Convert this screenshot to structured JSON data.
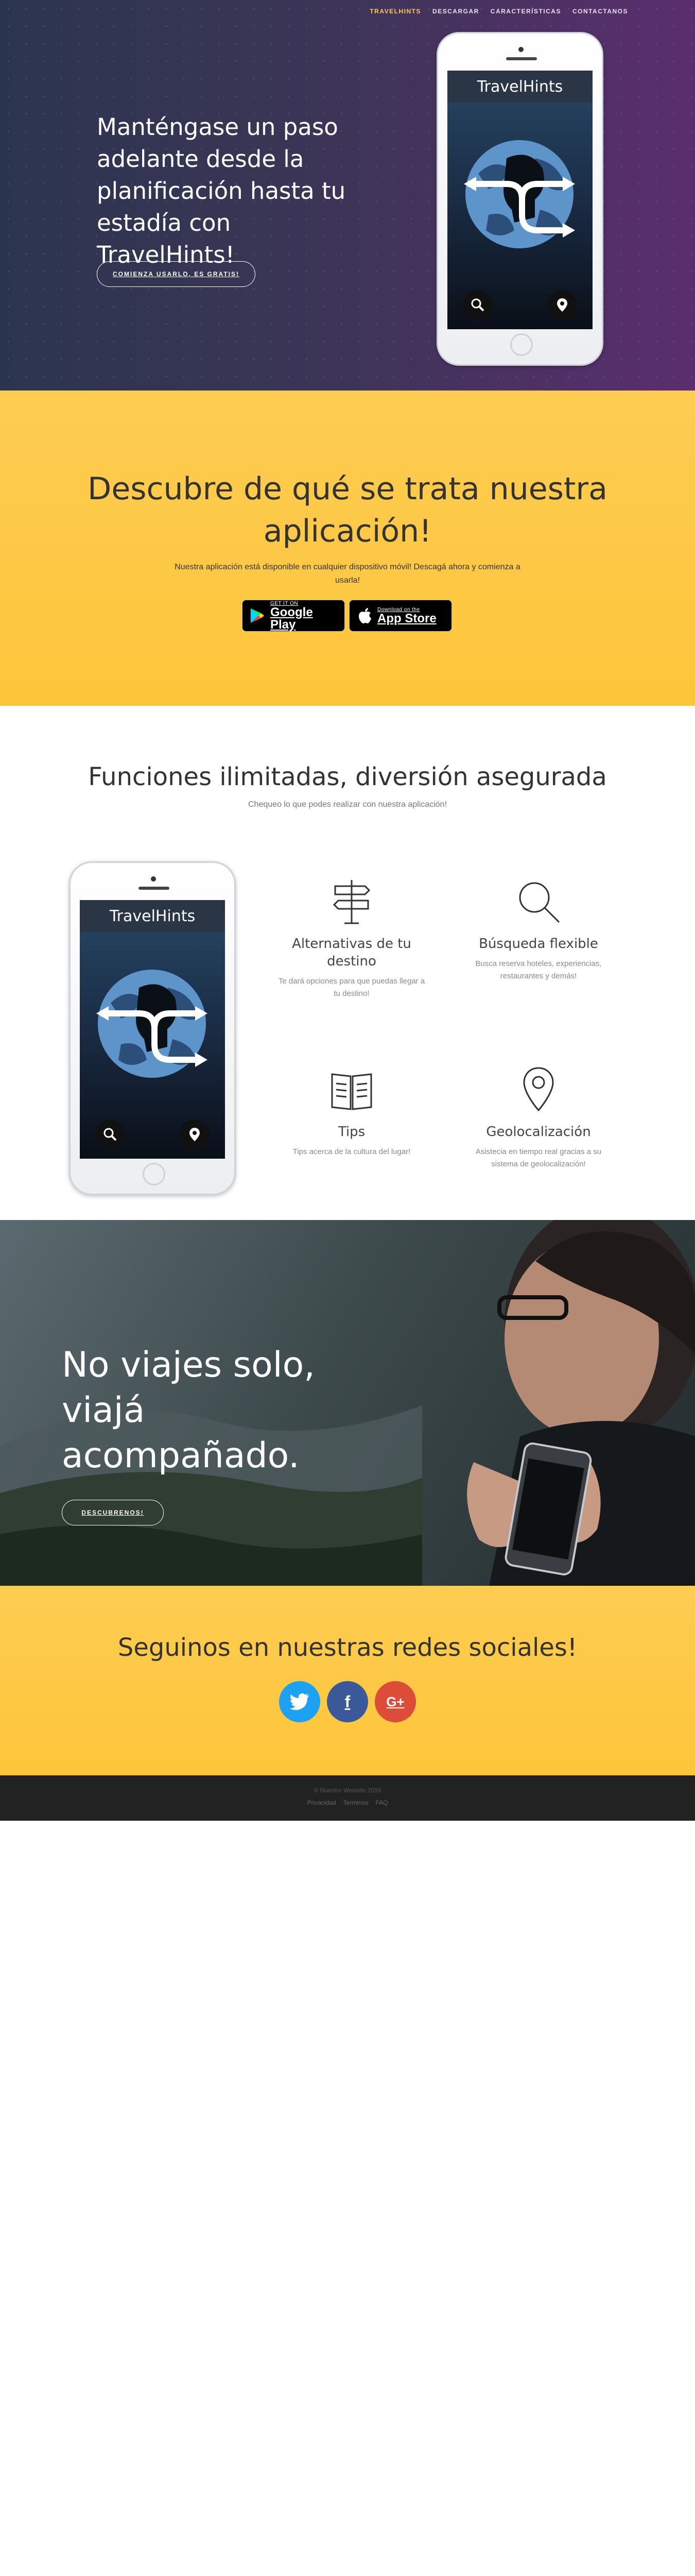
{
  "nav": {
    "brand": "TRAVELHINTS",
    "items": [
      "DESCARGAR",
      "CARACTERÍSTICAS",
      "CONTACTANOS"
    ]
  },
  "hero": {
    "headline": "Manténgase un paso adelante desde la planificación hasta tu estadía con TravelHints!",
    "cta_label": "COMIENZA USARLO, ES GRATIS!"
  },
  "phone": {
    "app_title": "TravelHints",
    "buttons": [
      "search-icon",
      "location-pin-icon"
    ]
  },
  "download": {
    "title": "Descubre de qué se trata nuestra aplicación!",
    "text": "Nuestra aplicación está disponible en cualquier dispositivo móvil! Descagá ahora y comienza a usarla!",
    "google_play": {
      "small": "GET IT ON",
      "big": "Google Play"
    },
    "app_store": {
      "small": "Download on the",
      "big": "App Store"
    }
  },
  "features": {
    "title": "Funciones ilimitadas, diversión asegurada",
    "subtitle": "Chequeo lo que podes realizar con nuestra aplicación!",
    "items": [
      {
        "icon": "signpost-icon",
        "title": "Alternativas de tu destino",
        "text": "Te dará opciones para que puedas llegar a tu destino!"
      },
      {
        "icon": "magnifier-icon",
        "title": "Búsqueda flexible",
        "text": "Busca reserva hoteles, experiencias, restaurantes y demás!"
      },
      {
        "icon": "book-icon",
        "title": "Tips",
        "text": "Tips acerca de la cultura del lugar!"
      },
      {
        "icon": "map-pin-icon",
        "title": "Geolocalización",
        "text": "Asistecia en tiempo real gracias a su sistema de geolocalización!"
      }
    ]
  },
  "cta": {
    "headline": "No viajes solo, viajá acompañado.",
    "button": "DESCUBRENOS!"
  },
  "social": {
    "title": "Seguinos en nuestras redes sociales!",
    "networks": [
      {
        "name": "twitter-icon",
        "glyph": "t",
        "color": "#1da1f2"
      },
      {
        "name": "facebook-icon",
        "glyph": "f",
        "color": "#3b5998"
      },
      {
        "name": "google-plus-icon",
        "glyph": "G+",
        "color": "#dd4b39"
      }
    ]
  },
  "footer": {
    "copyright": "© Nuestro Website 2016",
    "links": [
      "Privacidad",
      "Terminos",
      "FAQ"
    ]
  },
  "colors": {
    "accent": "#fdcc52",
    "hero_start": "#2c3550",
    "hero_end": "#5a2e6e",
    "footer": "#222222"
  }
}
